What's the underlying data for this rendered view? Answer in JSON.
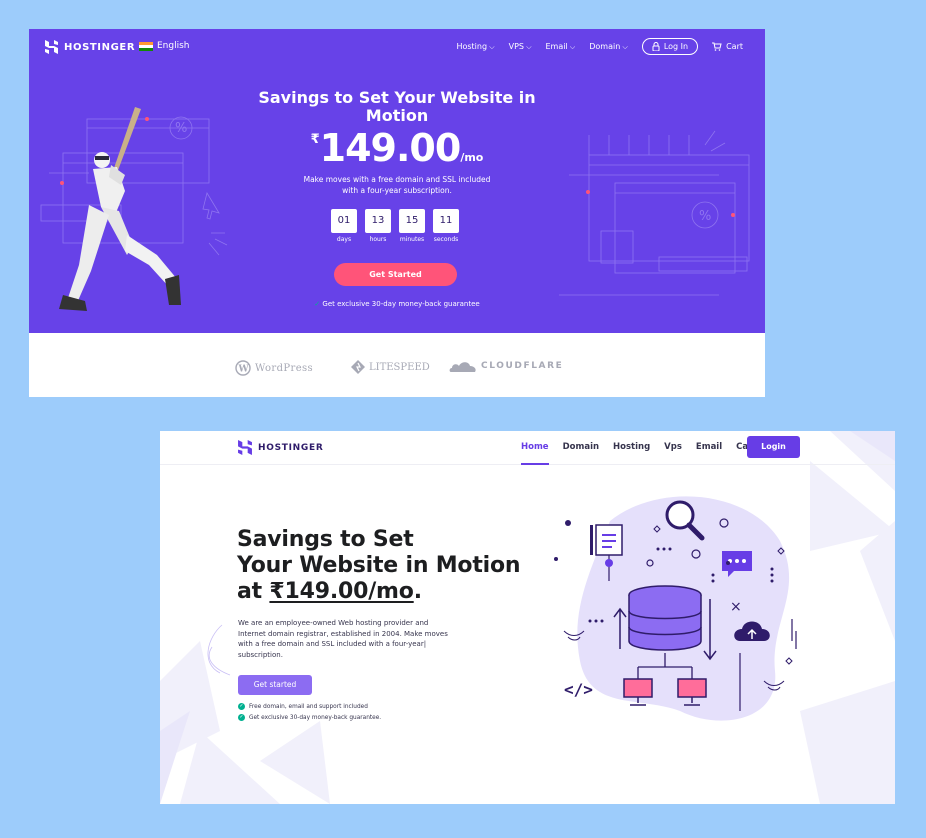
{
  "shot1": {
    "brand": "HOSTINGER",
    "language": "English",
    "nav": [
      "Hosting",
      "VPS",
      "Email",
      "Domain"
    ],
    "login": "Log In",
    "cart": "Cart",
    "title_line1": "Savings to Set Your Website in",
    "title_line2": "Motion",
    "price_currency": "₹",
    "price_amount": "149.00",
    "price_period": "/mo",
    "subtitle_line1": "Make moves with a free domain and SSL included",
    "subtitle_line2": "with a four-year subscription.",
    "countdown": [
      {
        "value": "01",
        "label": "days"
      },
      {
        "value": "13",
        "label": "hours"
      },
      {
        "value": "15",
        "label": "minutes"
      },
      {
        "value": "11",
        "label": "seconds"
      }
    ],
    "cta": "Get Started",
    "guarantee": "Get exclusive 30-day money-back guarantee",
    "partners": {
      "wordpress": "WordPress",
      "litespeed": "LITESPEED",
      "cloudflare": "CLOUDFLARE"
    },
    "colors": {
      "bg": "#6742e8",
      "cta": "#ff5479",
      "check": "#00b090"
    }
  },
  "shot2": {
    "brand": "HOSTINGER",
    "nav": [
      "Home",
      "Domain",
      "Hosting",
      "Vps",
      "Email",
      "Cart"
    ],
    "active_nav": "Home",
    "login": "Login",
    "title_line1": "Savings to Set",
    "title_line2": "Your Website in Motion",
    "title_line3_prefix": "at ",
    "title_price": "₹149.00/mo",
    "title_suffix": ".",
    "desc_line1": "We are an employee-owned Web hosting provider and",
    "desc_line2": "Internet domain registrar, established in 2004. Make moves",
    "desc_line3": "with a free domain and SSL included with a four-year|",
    "desc_line4": "subscription.",
    "cta": "Get started",
    "bullets": [
      "Free domain, email and support included",
      "Get exclusive 30-day money-back guarantee."
    ],
    "colors": {
      "primary": "#673de6",
      "cta": "#8c6cf2",
      "accent": "#ff6d9a"
    }
  }
}
